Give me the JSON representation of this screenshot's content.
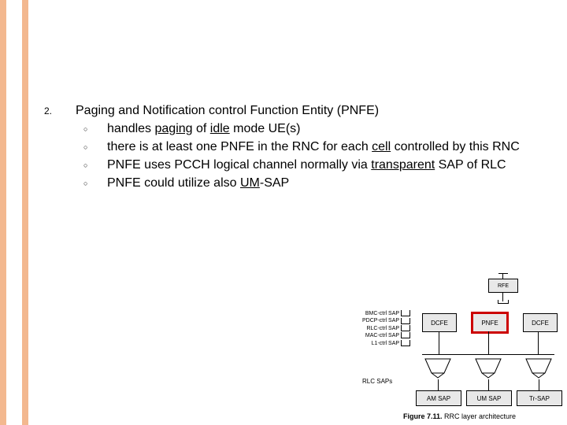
{
  "list_number": "2.",
  "title": "Paging and Notification control Function Entity (PNFE)",
  "bullets": {
    "b1_pre": "handles ",
    "b1_u1": "paging",
    "b1_mid": " of ",
    "b1_u2": "idle",
    "b1_post": " mode UE(s)",
    "b2_pre": "there is at least one PNFE in the RNC for each ",
    "b2_u": "cell",
    "b2_post": " controlled by this RNC",
    "b3_pre": "PNFE uses PCCH logical channel normally via ",
    "b3_u": "transparent",
    "b3_post": " SAP of RLC",
    "b4_pre": "PNFE could utilize also ",
    "b4_u": "UM",
    "b4_post": "-SAP"
  },
  "figure": {
    "rfe": "RFE",
    "saps": {
      "s1": "BMC-ctrl SAP",
      "s2": "PDCP-ctrl SAP",
      "s3": "RLC-ctrl SAP",
      "s4": "MAC-ctrl SAP",
      "s5": "L1-ctrl SAP"
    },
    "boxes": {
      "dcfe1": "DCFE",
      "pnfe": "PNFE",
      "dcfe2": "DCFE"
    },
    "rlc_saps": "RLC SAPs",
    "bottom": {
      "am": "AM SAP",
      "um": "UM SAP",
      "tr": "Tr-SAP"
    },
    "caption_bold": "Figure 7.11.",
    "caption_rest": " RRC layer architecture"
  }
}
